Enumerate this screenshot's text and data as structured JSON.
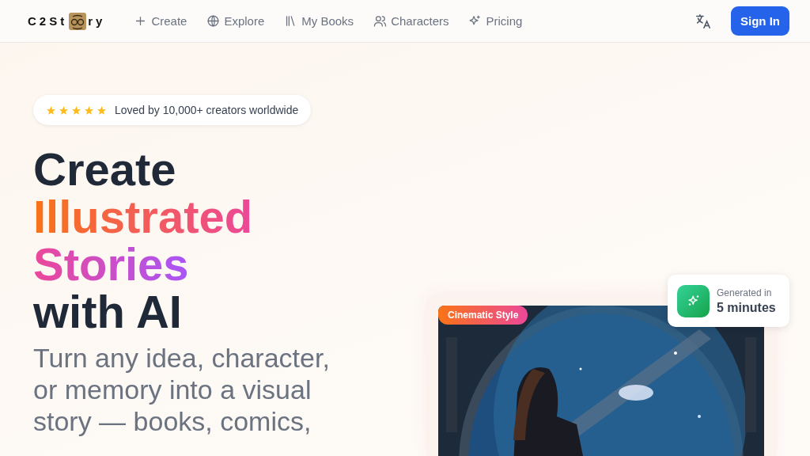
{
  "brand": {
    "before": "C2St",
    "after": "ry"
  },
  "nav": [
    {
      "label": "Create"
    },
    {
      "label": "Explore"
    },
    {
      "label": "My Books"
    },
    {
      "label": "Characters"
    },
    {
      "label": "Pricing"
    }
  ],
  "sign_in": "Sign In",
  "rating": {
    "stars": 5,
    "text": "Loved by 10,000+ creators worldwide"
  },
  "headline": [
    {
      "text": "Create",
      "kind": "plain"
    },
    {
      "text": "Illustrated",
      "kind": "warm"
    },
    {
      "text": "Stories",
      "kind": "violet"
    },
    {
      "text": "with AI",
      "kind": "plain"
    }
  ],
  "subtitle": [
    "Turn any idea, character,",
    "or memory into a visual",
    "story — books, comics,"
  ],
  "showcase": {
    "kind": "picture",
    "style_tag": "Cinematic Style",
    "generated_label": "Generated in",
    "generated_time": "5 minutes"
  }
}
